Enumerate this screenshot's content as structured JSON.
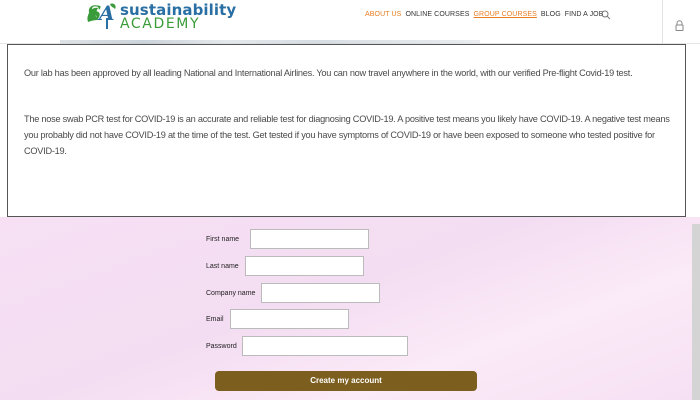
{
  "logo": {
    "top": "sustainability",
    "bottom": "ACADEMY"
  },
  "nav": [
    {
      "label": "ABOUT US",
      "accent": true,
      "underlined": false
    },
    {
      "label": "ONLINE COURSES",
      "accent": false,
      "underlined": false
    },
    {
      "label": "GROUP COURSES",
      "accent": true,
      "underlined": true
    },
    {
      "label": "BLOG",
      "accent": false,
      "underlined": false
    },
    {
      "label": "FIND A JOB",
      "accent": false,
      "underlined": false
    }
  ],
  "icons": {
    "search": "search-icon",
    "lock": "lock-icon"
  },
  "info": {
    "p1": "Our lab has been approved by all leading National and International Airlines. You can now travel anywhere in the world, with our verified Pre-flight Covid-19 test.",
    "p2": "The nose swab PCR test for COVID-19 is an accurate and reliable test for diagnosing COVID-19. A positive test means you likely have COVID-19. A negative test means you probably did not have COVID-19 at the time of the test. Get tested if you have symptoms of COVID-19 or have been exposed to someone who tested positive for COVID-19."
  },
  "form": {
    "first_name_label": "First name",
    "first_name_value": "",
    "last_name_label": "Last name",
    "last_name_value": "",
    "company_name_label": "Company name",
    "company_name_value": "",
    "email_label": "Email",
    "email_value": "",
    "password_label": "Password",
    "password_value": "",
    "submit_label": "Create my account"
  },
  "colors": {
    "nav_accent": "#e67e22",
    "logo_blue": "#2a6fa3",
    "logo_green": "#3a9b3a",
    "submit_bg": "#7c5e1e",
    "form_bg": "#f7e0f4"
  }
}
